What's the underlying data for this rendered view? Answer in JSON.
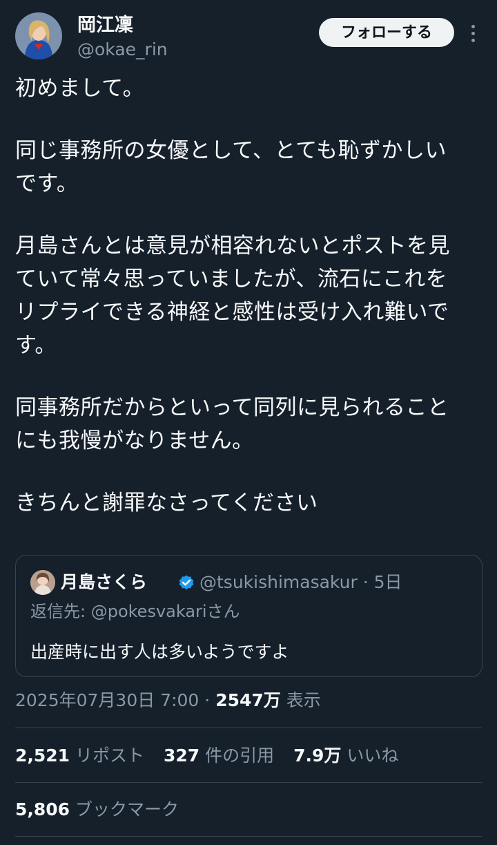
{
  "author": {
    "display_name": "岡江凜",
    "handle": "@okae_rin",
    "avatar_icon": "profile-photo"
  },
  "follow_label": "フォローする",
  "more_icon": "more-options-icon",
  "tweet": {
    "lines": [
      "初めまして。",
      "",
      "同じ事務所の女優として、とても恥ずかしい",
      "です。",
      "",
      "月島さんとは意見が相容れないとポストを見",
      "ていて常々思っていましたが、流石にこれを",
      "リプライできる神経と感性は受け入れ難いで",
      "す。",
      "",
      "同事務所だからといって同列に見られること",
      "にも我慢がなりません。",
      "",
      "きちんと謝罪なさってください"
    ]
  },
  "quote": {
    "display_name": "月島さくら",
    "verified_icon": "verified-badge-icon",
    "handle_time": "@tsukishimasakur · 5日",
    "reply_to": "返信先: @pokesvakariさん",
    "text": "出産時に出す人は多いようですよ"
  },
  "meta": {
    "timestamp": "2025年07月30日 7:00 · ",
    "views_count": "2547万",
    "views_label": " 表示"
  },
  "stats": {
    "reposts_count": "2,521",
    "reposts_label": " リポスト",
    "quotes_count": "327",
    "quotes_label": " 件の引用",
    "likes_count": "7.9万",
    "likes_label": " いいね",
    "bookmarks_count": "5,806",
    "bookmarks_label": " ブックマーク"
  },
  "colors": {
    "background": "#15202b",
    "text": "#f7f9f9",
    "secondary": "#8b98a5",
    "border": "#38444d",
    "verified": "#1d9bf0"
  }
}
